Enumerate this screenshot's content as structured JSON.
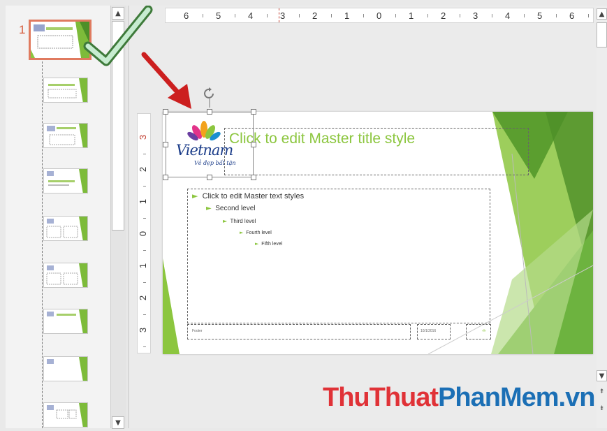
{
  "colors": {
    "accent_green": "#8cc63f",
    "dark_green": "#5b9e2f",
    "selection_orange": "#e07a5f",
    "arrow_red": "#cc1f1f",
    "watermark_red": "#e03237",
    "watermark_blue": "#1b6fb5"
  },
  "thumbnail_pane": {
    "selected_number": "1",
    "thumbnails": [
      {
        "name": "slide-master-thumb",
        "selected": true
      },
      {
        "name": "layout-thumb-1"
      },
      {
        "name": "layout-thumb-2"
      },
      {
        "name": "layout-thumb-3"
      },
      {
        "name": "layout-thumb-4"
      },
      {
        "name": "layout-thumb-5"
      },
      {
        "name": "layout-thumb-6"
      },
      {
        "name": "layout-thumb-7"
      },
      {
        "name": "layout-thumb-8"
      }
    ]
  },
  "ruler": {
    "horizontal_labels": [
      "6",
      "5",
      "4",
      "3",
      "2",
      "1",
      "0",
      "1",
      "2",
      "3",
      "4",
      "5",
      "6"
    ],
    "vertical_labels": [
      "3",
      "2",
      "1",
      "0",
      "1",
      "2",
      "3"
    ]
  },
  "slide": {
    "title_placeholder": "Click to edit Master title style",
    "body_levels": [
      "Click to edit Master text styles",
      "Second level",
      "Third level",
      "Fourth level",
      "Fifth level"
    ],
    "footer_text": "Footer",
    "date_text": "10/1/2016",
    "slide_number_text": "‹#›",
    "logo": {
      "word": "Vietnam",
      "tagline": "Vẻ đẹp bất tận"
    }
  },
  "icons": {
    "scroll_up": "▲",
    "scroll_down": "▼",
    "bullet": "►",
    "rotate": "rotate-handle-icon",
    "checkmark": "green-checkmark-icon",
    "arrow": "red-arrow-icon"
  },
  "watermark": {
    "part1": "ThuThuat",
    "part2": "PhanMem",
    "part3": ".vn"
  }
}
